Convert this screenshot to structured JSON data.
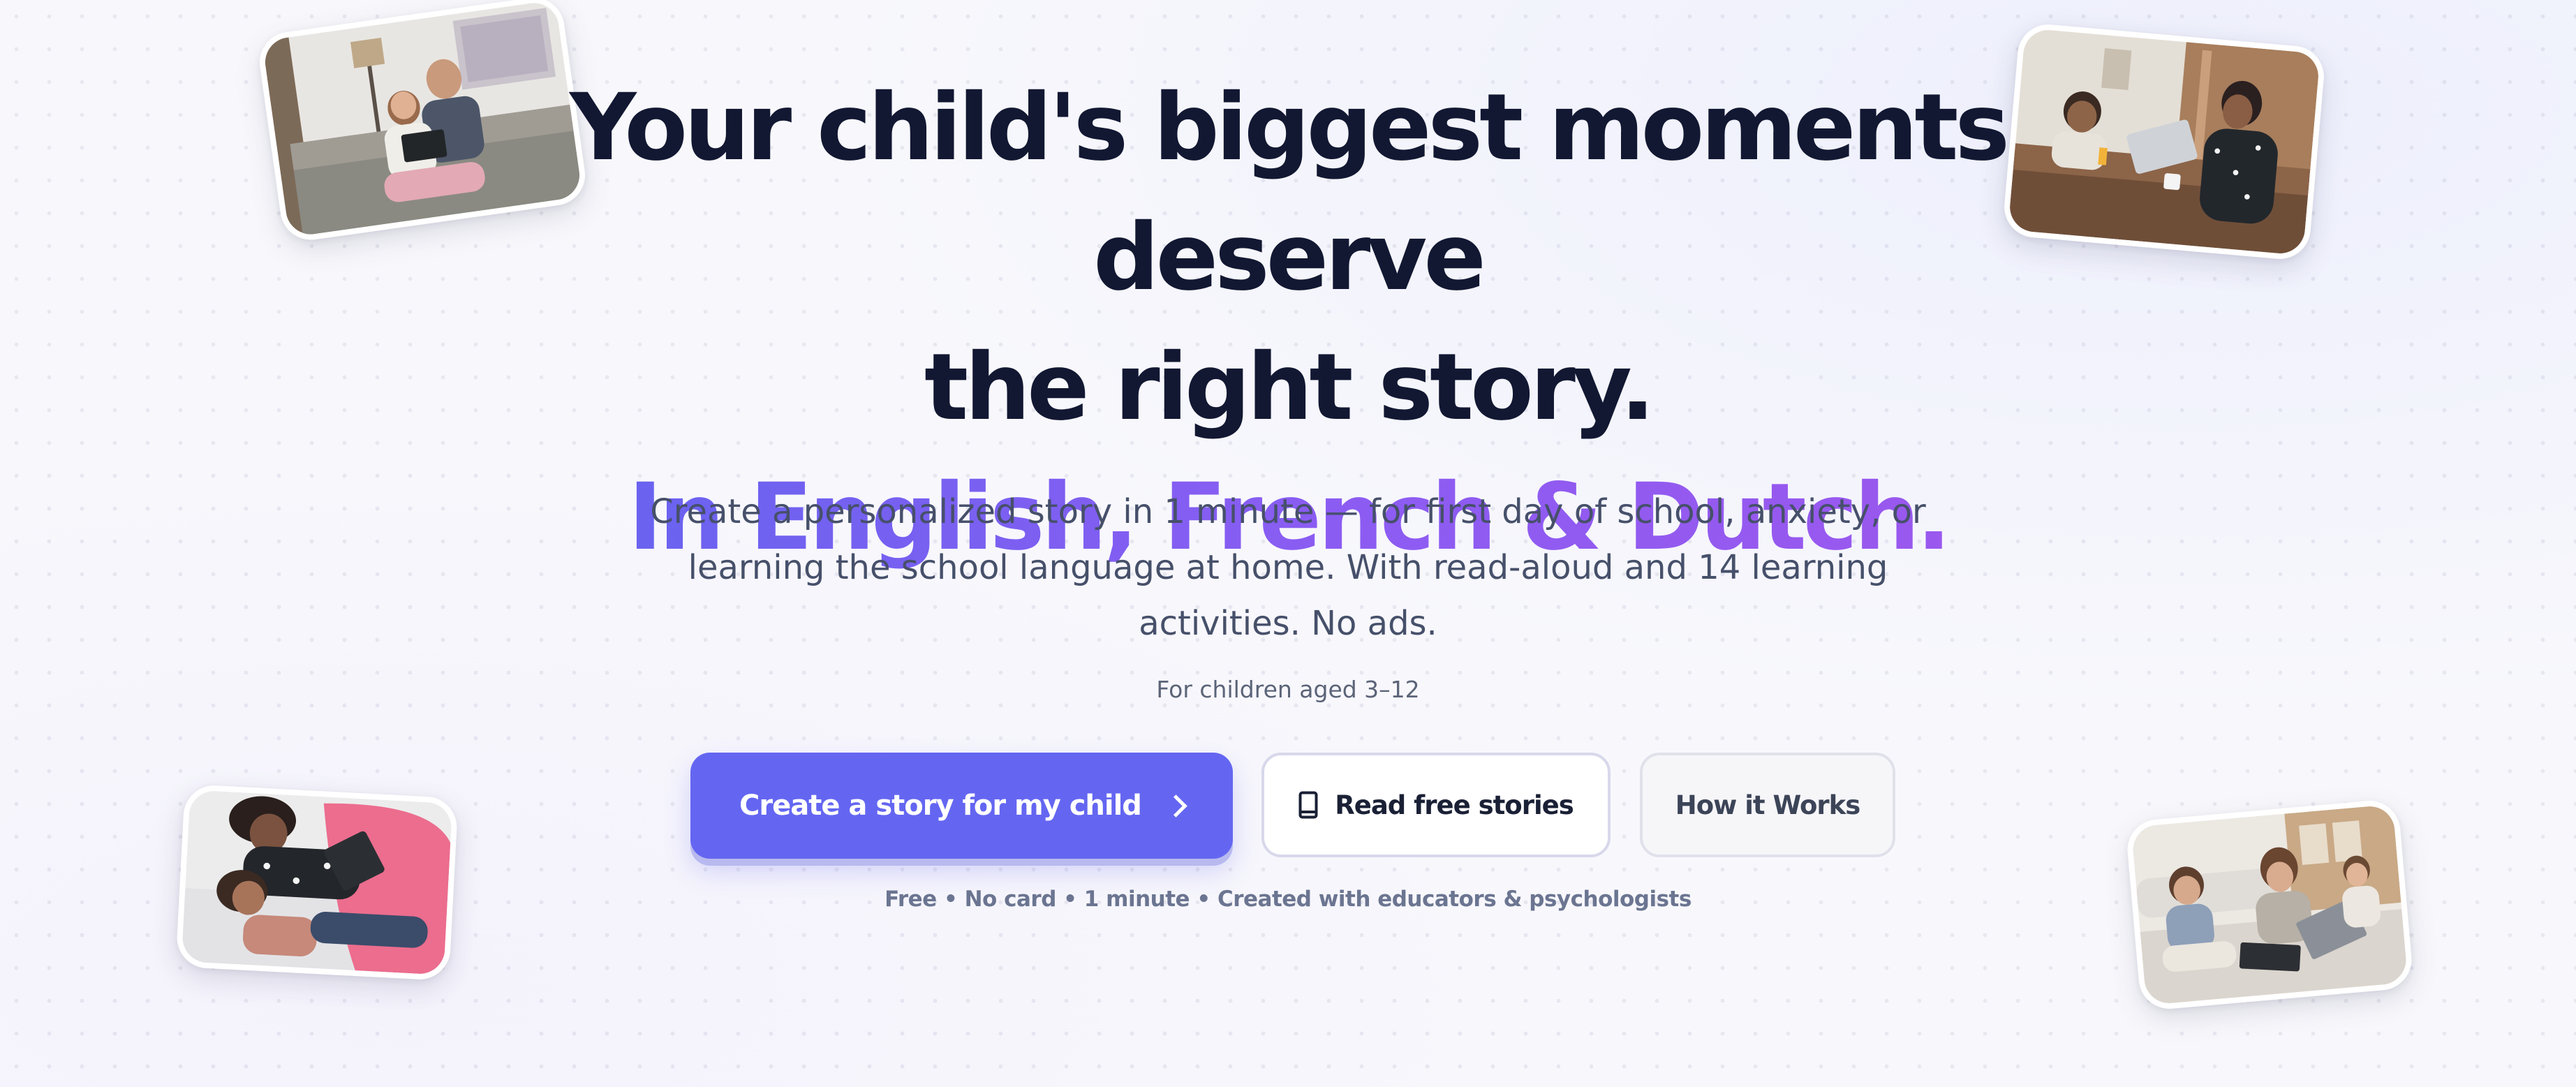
{
  "hero": {
    "headline_line1": "Your child's biggest moments deserve",
    "headline_line2": "the right story.",
    "headline_accent": "In English, French & Dutch.",
    "subtitle": "Create a personalized story in 1 minute — for first day of school, anxiety, or learning the school language at home. With read-aloud and 14 learning activities. No ads.",
    "ages_note": "For children aged 3–12",
    "trust_line": "Free • No card • 1 minute • Created with educators & psychologists"
  },
  "buttons": {
    "primary_label": "Create a story for my child",
    "primary_icon": "chevron-right-icon",
    "secondary_label": "Read free stories",
    "secondary_icon": "book-icon",
    "tertiary_label": "How it Works"
  },
  "colors": {
    "primary": "#6466F1",
    "accent_gradient_start": "#6A63F0",
    "accent_gradient_end": "#9A58EE",
    "heading": "#121832",
    "body_text": "#46506A",
    "background": "#F8F8FC"
  },
  "photos": [
    {
      "id": "photo-father-daughter-tablet",
      "subject": "father and daughter reading a tablet on a sofa"
    },
    {
      "id": "photo-mother-child-table",
      "subject": "mother and child working at a table with a laptop"
    },
    {
      "id": "photo-mother-daughter-bed",
      "subject": "mother and daughter lying on a bed with a tablet"
    },
    {
      "id": "photo-family-floor",
      "subject": "mother and two children on the floor with a laptop"
    }
  ]
}
